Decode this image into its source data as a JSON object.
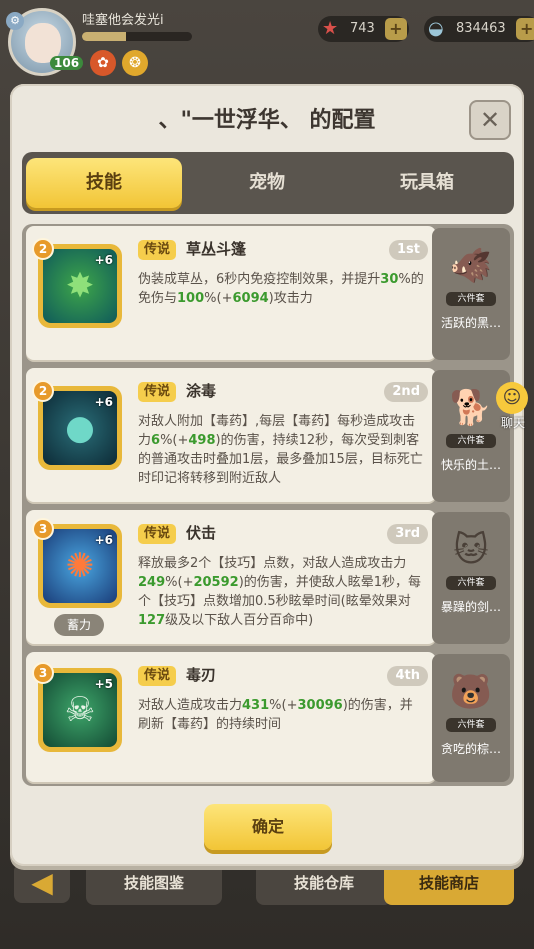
{
  "player": {
    "name": "哇塞他会发光i",
    "level": "106",
    "exp_fraction": 0.4
  },
  "resources": [
    {
      "icon": "starfish-icon",
      "value": "743"
    },
    {
      "icon": "shell-icon",
      "value": "834463"
    }
  ],
  "modal": {
    "title": "、\"一世浮华、 的配置",
    "tabs": [
      "技能",
      "宠物",
      "玩具箱"
    ],
    "active_tab": 0,
    "confirm_label": "确定"
  },
  "skills": [
    {
      "rank": "2",
      "plus": "+6",
      "rarity": "传说",
      "name": "草丛斗篷",
      "slot": "1st",
      "desc": [
        {
          "t": "伪装成草丛，6秒内免疫控制效果，并提升"
        },
        {
          "t": "30",
          "g": true
        },
        {
          "t": "%的免伤与"
        },
        {
          "t": "100",
          "g": true
        },
        {
          "t": "%(+"
        },
        {
          "t": "6094",
          "g": true
        },
        {
          "t": ")攻击力"
        }
      ]
    },
    {
      "rank": "2",
      "plus": "+6",
      "rarity": "传说",
      "name": "涂毒",
      "slot": "2nd",
      "desc": [
        {
          "t": "对敌人附加【毒药】,每层【毒药】每秒造成攻击力"
        },
        {
          "t": "6",
          "g": true
        },
        {
          "t": "%(+"
        },
        {
          "t": "498",
          "g": true
        },
        {
          "t": ")的伤害，持续12秒，每次受到刺客的普通攻击时叠加1层，最多叠加15层，目标死亡时印记将转移到附近敌人"
        }
      ]
    },
    {
      "rank": "3",
      "plus": "+6",
      "rarity": "传说",
      "name": "伏击",
      "slot": "3rd",
      "charge": "蓄力",
      "desc": [
        {
          "t": "释放最多2个【技巧】点数，对敌人造成攻击力"
        },
        {
          "t": "249",
          "g": true
        },
        {
          "t": "%(+"
        },
        {
          "t": "20592",
          "g": true
        },
        {
          "t": ")的伤害，并使敌人眩晕1秒，每个【技巧】点数增加0.5秒眩晕时间(眩晕效果对"
        },
        {
          "t": "127",
          "g": true
        },
        {
          "t": "级及以下敌人百分百命中)"
        }
      ]
    },
    {
      "rank": "3",
      "plus": "+5",
      "rarity": "传说",
      "name": "毒刃",
      "slot": "4th",
      "desc": [
        {
          "t": "对敌人造成攻击力"
        },
        {
          "t": "431",
          "g": true
        },
        {
          "t": "%(+"
        },
        {
          "t": "30096",
          "g": true
        },
        {
          "t": ")的伤害，并刷新【毒药】的持续时间"
        }
      ]
    }
  ],
  "side_items": [
    {
      "name": "活跃的黑…",
      "tag": "六件套",
      "icon": "boar-figure-icon"
    },
    {
      "name": "快乐的土…",
      "tag": "六件套",
      "icon": "dog-figure-icon"
    },
    {
      "name": "暴躁的剑…",
      "tag": "六件套",
      "icon": "cat-figure-icon"
    },
    {
      "name": "贪吃的棕…",
      "tag": "六件套",
      "icon": "bear-figure-icon"
    }
  ],
  "chat_label": "聊天",
  "bottom_buttons": [
    "技能图鉴",
    "技能仓库",
    "技能商店"
  ]
}
